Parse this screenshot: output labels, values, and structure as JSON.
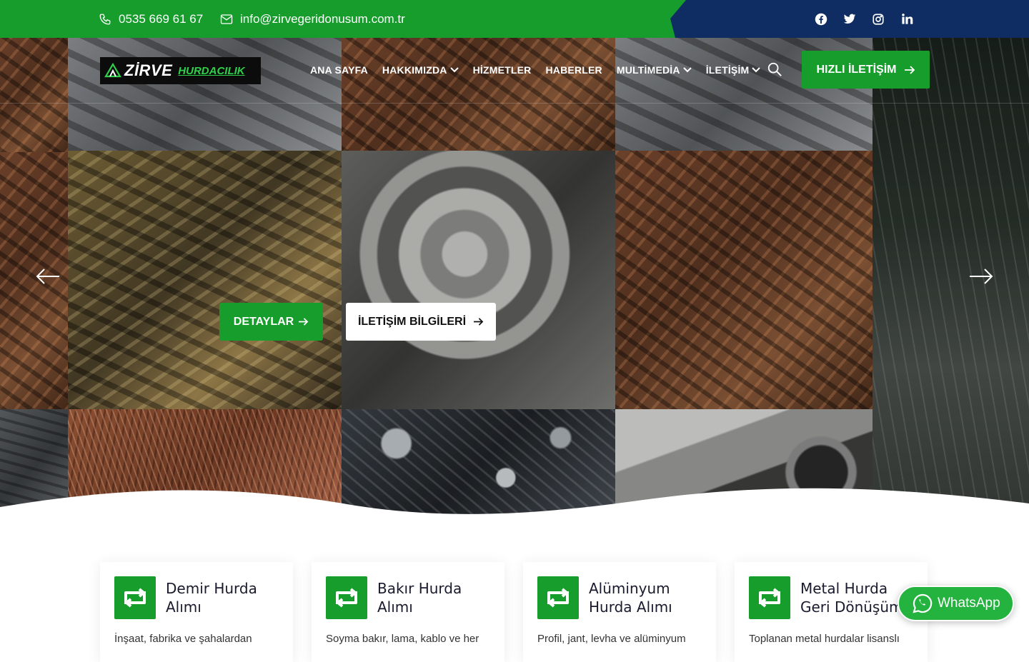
{
  "topbar": {
    "phone": "0535 669 61 67",
    "email": "info@zirvegeridonusum.com.tr",
    "socials": [
      "facebook-icon",
      "twitter-icon",
      "instagram-icon",
      "linkedin-icon"
    ]
  },
  "brand": {
    "name": "ZİRVE",
    "tagline": "HURDACILIK",
    "accent": "#179d2c",
    "topbar_dark": "#0f2d63"
  },
  "nav": {
    "items": [
      {
        "label": "ANA SAYFA",
        "dropdown": false
      },
      {
        "label": "HAKKIMIZDA",
        "dropdown": true
      },
      {
        "label": "HİZMETLER",
        "dropdown": false
      },
      {
        "label": "HABERLER",
        "dropdown": false
      },
      {
        "label": "MULTİMEDİA",
        "dropdown": true
      },
      {
        "label": "İLETİŞİM",
        "dropdown": true
      }
    ],
    "quick_contact": "HIZLI İLETİŞİM"
  },
  "hero": {
    "details_button": "DETAYLAR",
    "contact_info_button": "İLETİŞİM BİLGİLERİ"
  },
  "services": [
    {
      "title": "Demir Hurda Alımı",
      "text": "İnşaat, fabrika ve şahalardan"
    },
    {
      "title": "Bakır Hurda Alımı",
      "text": "Soyma bakır, lama, kablo ve her"
    },
    {
      "title": "Alüminyum Hurda Alımı",
      "text": "Profil, jant, levha ve alüminyum"
    },
    {
      "title": "Metal Hurda Geri Dönüşüm",
      "text": "Toplanan metal hurdalar lisanslı"
    }
  ],
  "whatsapp": {
    "label": "WhatsApp"
  }
}
